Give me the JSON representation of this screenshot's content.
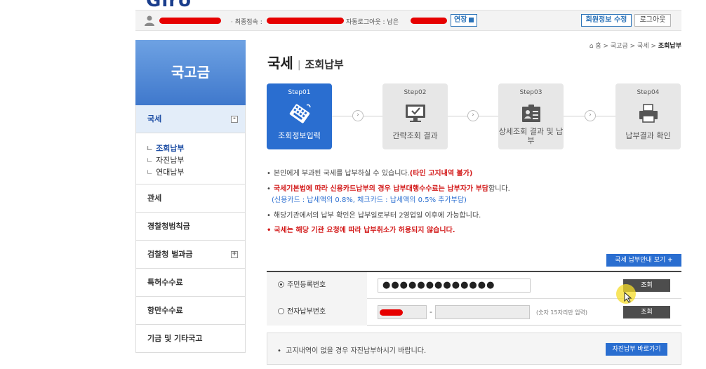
{
  "logo": {
    "text": "Giro"
  },
  "userbar": {
    "login_label": "· 최종접속 :",
    "autologout_label": "자동로그아웃 : 남은",
    "extend_label": "연장",
    "edit_info_label": "회원정보 수정",
    "logout_label": "로그아웃"
  },
  "sidebar": {
    "title": "국고금",
    "items": [
      {
        "label": "국세"
      },
      {
        "label": "관세"
      },
      {
        "label": "경찰청범칙금"
      },
      {
        "label": "검찰청 벌과금"
      },
      {
        "label": "특허수수료"
      },
      {
        "label": "항만수수료"
      },
      {
        "label": "기금 및 기타국고"
      }
    ],
    "sub_items": [
      {
        "label": "조회납부"
      },
      {
        "label": "자진납부"
      },
      {
        "label": "연대납부"
      }
    ],
    "expand_symbol": "-",
    "collapse_symbol": "+"
  },
  "breadcrumb": {
    "home": "홈",
    "path": " > 국고금 > 국세 > ",
    "current": "조회납부"
  },
  "page": {
    "title": "국세",
    "subtitle": "조회납부"
  },
  "steps": [
    {
      "num": "Step01",
      "label": "조회정보입력",
      "icon": "keyboard-icon"
    },
    {
      "num": "Step02",
      "label": "간략조회 결과",
      "icon": "monitor-check-icon"
    },
    {
      "num": "Step03",
      "label": "상세조회 결과 및 납부",
      "icon": "id-card-icon"
    },
    {
      "num": "Step04",
      "label": "납부결과 확인",
      "icon": "printer-icon"
    }
  ],
  "notices": {
    "n1_text": "본인에게 부과된 국세를 납부하실 수 있습니다.",
    "n1_bold": "(타인 고지내역 불가)",
    "n2_red": "국세기본법에 따라 신용카드납부의 경우 납부대행수수료는 납부자가 부담",
    "n2_tail": "합니다.",
    "n3": "(신용카드 : 납세액의 0.8%, 체크카드 : 납세액의 0.5% 추가부담)",
    "n4": "해당기관에서의 납부 확인은 납부일로부터 2영업일 이후에 가능합니다.",
    "n5": "국세는 해당 기관 요청에 따라 납부취소가 허용되지 않습니다."
  },
  "guide_button": "국세 납부안내 보기",
  "form": {
    "row1_label": "주민등록번호",
    "row1_value": "●●●●●●●●●●●●●",
    "row2_label": "전자납부번호",
    "row2_hint": "(숫자 15자리만 입력)",
    "dash": "-",
    "query_label": "조회"
  },
  "bottom": {
    "text": "고지내역이 없을 경우 자진납부하시기 바랍니다.",
    "button": "자진납부 바로가기"
  },
  "colors": {
    "primary": "#2a6ed0",
    "alert": "#d31a1a",
    "sidebar_head": "#4a82d2"
  }
}
